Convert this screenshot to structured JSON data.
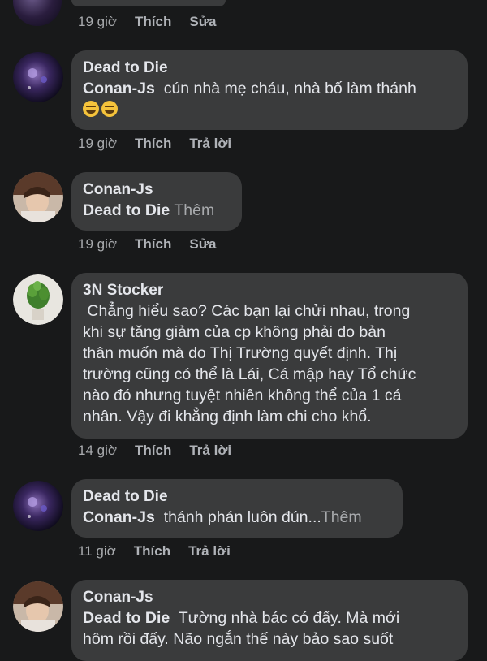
{
  "comments": [
    {
      "time": "19 giờ",
      "like": "Thích",
      "action": "Sửa"
    },
    {
      "author": "Dead to Die",
      "mention": "Conan-Js",
      "text": "  cún nhà mẹ cháu, nhà bố làm thánh",
      "emoji": "grinning-squinting-face",
      "time": "19 giờ",
      "like": "Thích",
      "action": "Trả lời"
    },
    {
      "author": "Conan-Js",
      "mention": "Dead to Die",
      "more": "Thêm",
      "time": "19 giờ",
      "like": "Thích",
      "action": "Sửa"
    },
    {
      "author": "3N Stocker",
      "lines": [
        " Chẳng hiểu sao? Các bạn lại chửi nhau, trong",
        "khi sự tăng giảm của cp không phải do bản",
        "thân muốn mà do Thị Trường quyết định. Thị",
        "trường cũng có thể là Lái, Cá mập hay Tổ chức",
        "nào đó nhưng tuyệt nhiên không thể của 1 cá",
        "nhân. Vậy đi khẳng định làm chi cho khổ."
      ],
      "time": "14 giờ",
      "like": "Thích",
      "action": "Trả lời"
    },
    {
      "author": "Dead to Die",
      "mention": "Conan-Js",
      "text": "  thánh phán luôn đún...",
      "more": "Thêm",
      "time": "11 giờ",
      "like": "Thích",
      "action": "Trả lời"
    },
    {
      "author": "Conan-Js",
      "mention": "Dead to Die",
      "text": "  Tường nhà bác có đấy. Mà mới",
      "line2": "hôm rồi đấy. Não ngắn thế này bảo sao suốt"
    }
  ]
}
